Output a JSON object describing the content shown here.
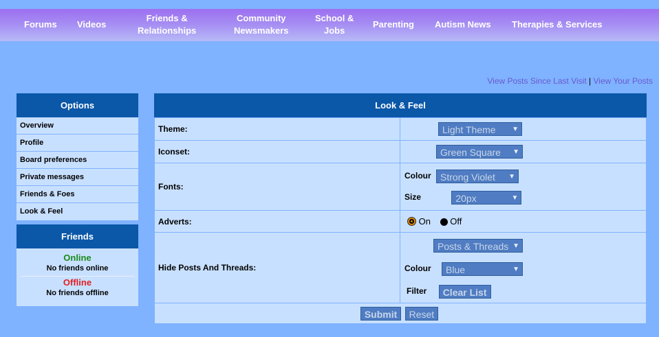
{
  "nav": {
    "forums": "Forums",
    "videos": "Videos",
    "friends_l1": "Friends &",
    "friends_l2": "Relationships",
    "community_l1": "Community",
    "community_l2": "Newsmakers",
    "school_l1": "School &",
    "school_l2": "Jobs",
    "parenting": "Parenting",
    "autism_news": "Autism News",
    "therapies": "Therapies & Services"
  },
  "toplinks": {
    "since_last": "View Posts Since Last Visit",
    "sep": "|",
    "your_posts": "View Your Posts"
  },
  "options": {
    "header": "Options",
    "items": [
      "Overview",
      "Profile",
      "Board preferences",
      "Private messages",
      "Friends & Foes",
      "Look & Feel"
    ]
  },
  "friends": {
    "header": "Friends",
    "online_label": "Online",
    "online_text": "No friends online",
    "offline_label": "Offline",
    "offline_text": "No friends offline"
  },
  "main": {
    "header": "Look & Feel",
    "theme_label": "Theme:",
    "theme_value": "Light Theme",
    "iconset_label": "Iconset:",
    "iconset_value": "Green Square",
    "fonts_label": "Fonts:",
    "colour_label": "Colour",
    "font_colour_value": "Strong Violet",
    "size_label": "Size",
    "size_value": "20px",
    "adverts_label": "Adverts:",
    "adverts_on": "On",
    "adverts_off": "Off",
    "adverts_selected": "On",
    "hide_label": "Hide Posts And Threads:",
    "hide_value": "Posts & Threads",
    "hide_colour_label": "Colour",
    "hide_colour_value": "Blue",
    "filter_label": "Filter",
    "clear_list": "Clear List",
    "submit": "Submit",
    "reset": "Reset"
  },
  "colors": {
    "header_blue": "#0b57a8",
    "online_green": "#1a8a1a",
    "offline_red": "#e02020",
    "radio_orange": "#e08a00"
  },
  "icons": {
    "dropdown": "chevron-down-icon"
  }
}
